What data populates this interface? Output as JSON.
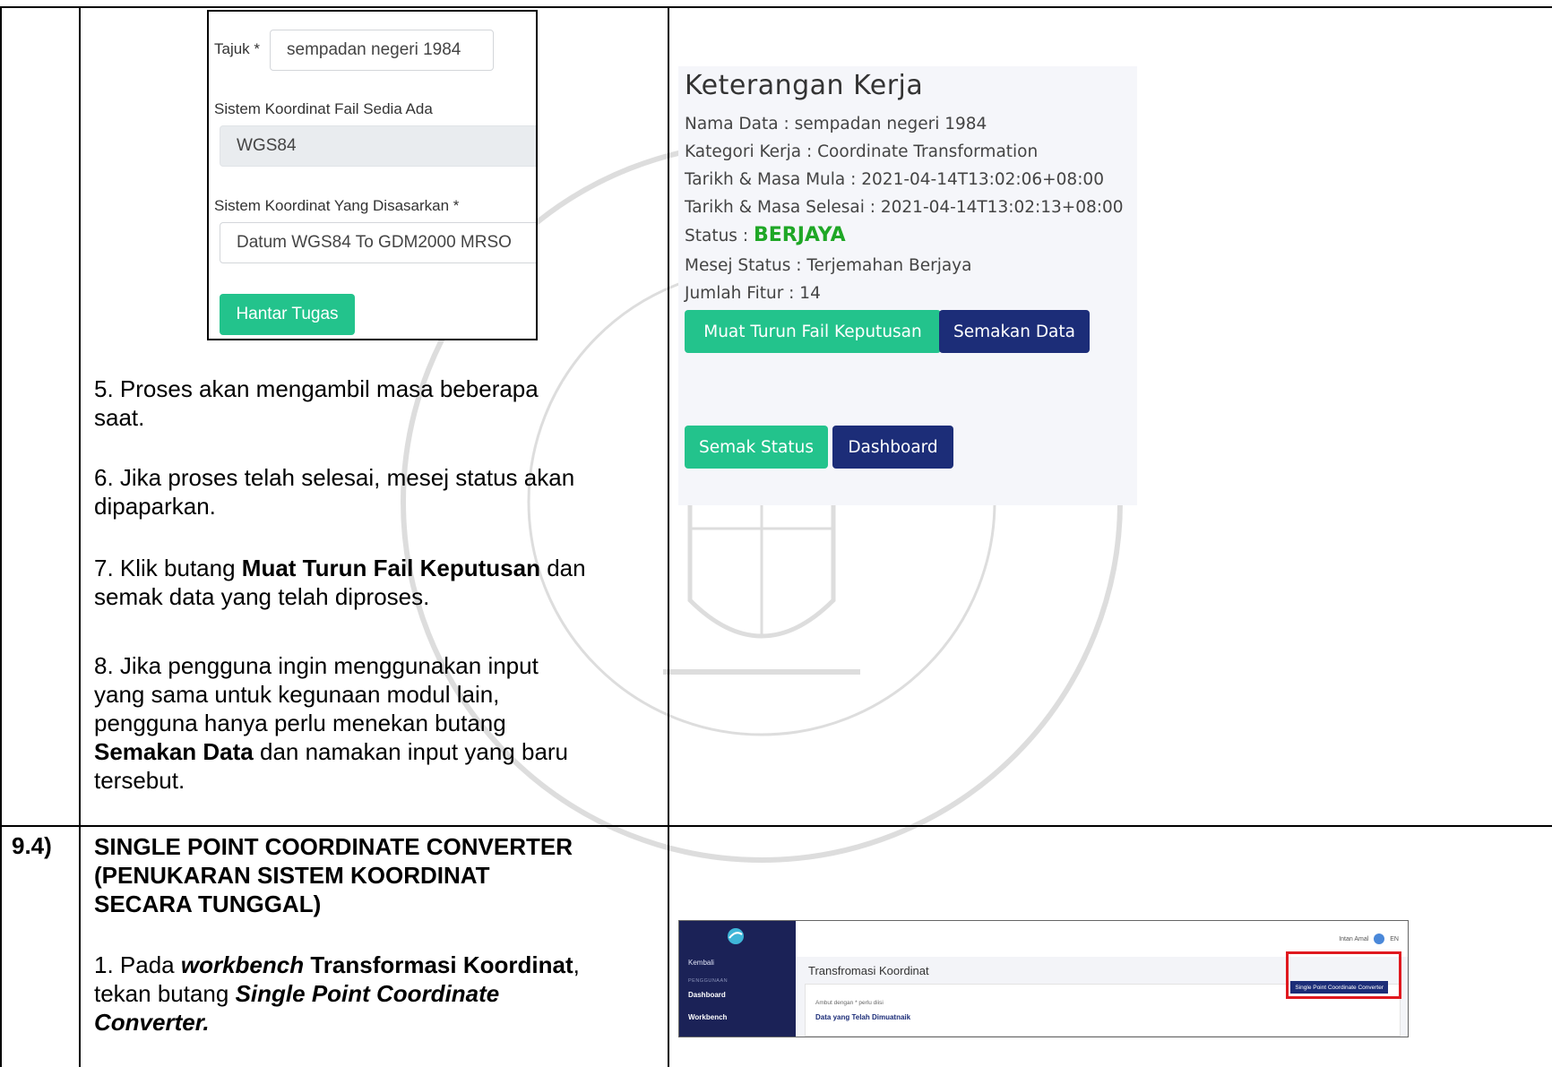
{
  "form": {
    "title_label": "Tajuk *",
    "title_value": "sempadan negeri 1984",
    "existing_crs_label": "Sistem Koordinat Fail Sedia Ada",
    "existing_crs_value": "WGS84",
    "target_crs_label": "Sistem Koordinat Yang Disasarkan *",
    "target_crs_value": "Datum WGS84 To GDM2000 MRSO",
    "submit_label": "Hantar Tugas"
  },
  "steps": {
    "step5_line1": "5. Proses akan mengambil masa beberapa",
    "step5_line2": "saat.",
    "step6_line1": "6. Jika proses telah selesai, mesej status akan",
    "step6_line2": "dipaparkan.",
    "step7_pre": "7. Klik butang ",
    "step7_bold": "Muat Turun Fail Keputusan",
    "step7_post": " dan",
    "step7_line2": "semak data yang telah diproses.",
    "step8_line1": "8. Jika pengguna ingin menggunakan input",
    "step8_line2": "yang sama untuk kegunaan modul lain,",
    "step8_line3": "pengguna hanya perlu menekan butang",
    "step8_bold": "Semakan Data",
    "step8_line4_post": " dan namakan input yang baru",
    "step8_line5": "tersebut."
  },
  "panel": {
    "title": "Keterangan Kerja",
    "nama_data": "Nama Data : sempadan negeri 1984",
    "kategori": "Kategori Kerja : Coordinate Transformation",
    "mula": "Tarikh & Masa Mula : 2021-04-14T13:02:06+08:00",
    "selesai": "Tarikh & Masa Selesai : 2021-04-14T13:02:13+08:00",
    "status_label": "Status : ",
    "status_value": "BERJAYA",
    "mesej": "Mesej Status : Terjemahan Berjaya",
    "jumlah": "Jumlah Fitur : 14",
    "download_btn": "Muat Turun Fail Keputusan",
    "check_data_btn": "Semakan Data",
    "check_status_btn": "Semak Status",
    "dashboard_btn": "Dashboard",
    "status_color": "#1fa726"
  },
  "section": {
    "number": "9.4)",
    "heading_line1": "SINGLE POINT COORDINATE CONVERTER",
    "heading_line2": "(PENUKARAN SISTEM KOORDINAT",
    "heading_line3": "SECARA TUNGGAL)",
    "step1_pre": "1. Pada ",
    "step1_em": "workbench",
    "step1_bold": " Transformasi Koordinat",
    "step1_comma": ",",
    "step1_line2_pre": "tekan butang ",
    "step1_line2_em": "Single Point Coordinate",
    "step1_line3_em": "Converter."
  },
  "mini_app": {
    "back": "Kembali",
    "section_label": "PENGGUNAAN",
    "dashboard": "Dashboard",
    "workbench": "Workbench",
    "user_name": "Intan Amal",
    "lang": "EN",
    "page_title": "Transfromasi Koordinat",
    "button": "Single Point Coordinate Converter",
    "required_note": "Ambut dengan * perlu diisi",
    "data_heading": "Data yang Telah Dimuatnaik"
  }
}
